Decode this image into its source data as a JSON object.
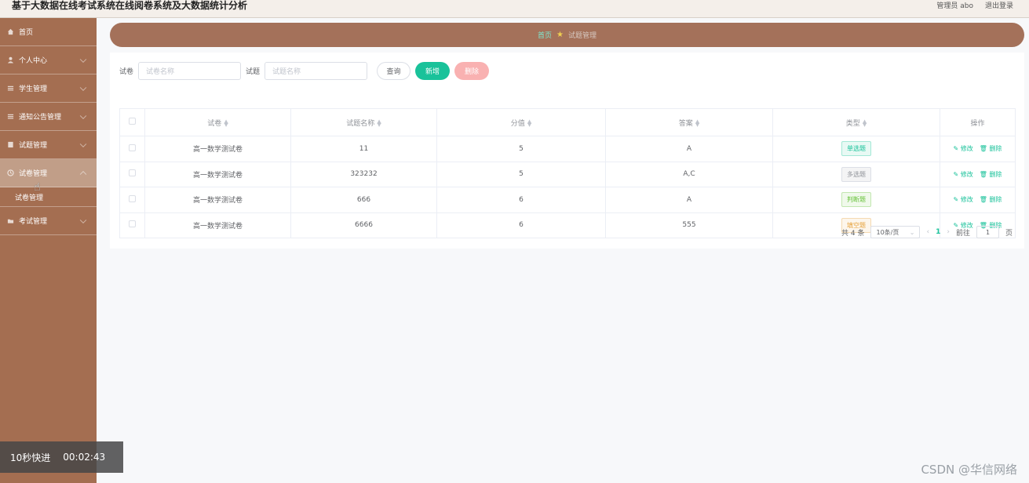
{
  "app": {
    "title": "基于大数据在线考试系统在线阅卷系统及大数据统计分析",
    "user_label": "管理员 abo",
    "logout": "退出登录"
  },
  "sidebar": {
    "items": [
      {
        "label": "首页",
        "icon": "home-icon"
      },
      {
        "label": "个人中心",
        "icon": "user-icon"
      },
      {
        "label": "学生管理",
        "icon": "list-icon"
      },
      {
        "label": "通知公告管理",
        "icon": "list-icon"
      },
      {
        "label": "试题管理",
        "icon": "document-icon"
      },
      {
        "label": "试卷管理",
        "icon": "clock-icon"
      },
      {
        "label": "考试管理",
        "icon": "folder-icon"
      }
    ],
    "submenu": "试卷管理"
  },
  "breadcrumb": {
    "home": "首页",
    "current": "试题管理"
  },
  "search": {
    "paper_label": "试卷",
    "paper_placeholder": "试卷名称",
    "question_label": "试题",
    "question_placeholder": "试题名称",
    "query_btn": "查询",
    "add_btn": "新增",
    "delete_btn": "删除"
  },
  "table": {
    "headers": [
      "试卷",
      "试题名称",
      "分值",
      "答案",
      "类型",
      "操作"
    ],
    "rows": [
      {
        "paper": "高一数学测试卷",
        "name": "11",
        "score": "5",
        "answer": "A",
        "type": "单选题",
        "type_color": "#19c29a"
      },
      {
        "paper": "高一数学测试卷",
        "name": "323232",
        "score": "5",
        "answer": "A,C",
        "type": "多选题",
        "type_color": "#909399"
      },
      {
        "paper": "高一数学测试卷",
        "name": "666",
        "score": "6",
        "answer": "A",
        "type": "判断题",
        "type_color": "#67c23a"
      },
      {
        "paper": "高一数学测试卷",
        "name": "6666",
        "score": "6",
        "answer": "555",
        "type": "填空题",
        "type_color": "#e6a23c"
      }
    ],
    "edit_label": "修改",
    "delete_label": "删除"
  },
  "pagination": {
    "total": "共 4 条",
    "page_size": "10条/页",
    "current_page": "1",
    "goto_label": "前往",
    "goto_value": "1",
    "page_suffix": "页"
  },
  "video": {
    "skip": "10秒快进",
    "time": "00:02:43"
  },
  "watermark": "CSDN @华信网络",
  "colors": {
    "sidebar": "#a46e51",
    "accent": "#19c29a",
    "danger_light": "#f9b1b1"
  }
}
